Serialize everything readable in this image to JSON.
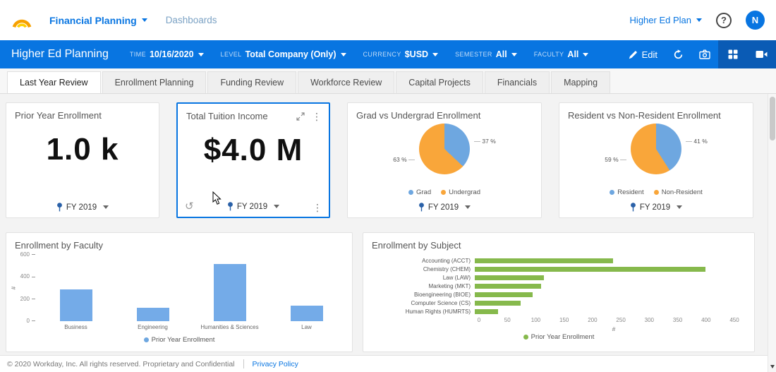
{
  "topbar": {
    "brand_nav": {
      "primary": "Financial Planning",
      "secondary": "Dashboards"
    },
    "plan_selector": "Higher Ed Plan",
    "avatar_initial": "N"
  },
  "icons": {
    "kebab": "⋮",
    "undo": "↺",
    "help": "?"
  },
  "toolbar": {
    "title": "Higher Ed Planning",
    "filters": [
      {
        "label": "TIME",
        "value": "10/16/2020"
      },
      {
        "label": "LEVEL",
        "value": "Total Company (Only)"
      },
      {
        "label": "CURRENCY",
        "value": "$USD"
      },
      {
        "label": "SEMESTER",
        "value": "All"
      },
      {
        "label": "FACULTY",
        "value": "All"
      }
    ],
    "edit_label": "Edit"
  },
  "tabs": [
    {
      "label": "Last Year Review",
      "active": true
    },
    {
      "label": "Enrollment Planning",
      "active": false
    },
    {
      "label": "Funding Review",
      "active": false
    },
    {
      "label": "Workforce Review",
      "active": false
    },
    {
      "label": "Capital Projects",
      "active": false
    },
    {
      "label": "Financials",
      "active": false
    },
    {
      "label": "Mapping",
      "active": false
    }
  ],
  "colors": {
    "workday_blue": "#0875e1",
    "toolbar_active_tile": "#0a5bb5",
    "pie_blue": "#6ea7e0",
    "pie_orange": "#f9a63a",
    "bar_blue": "#74abe8",
    "bar_green": "#86b94c"
  },
  "chart_data": [
    {
      "type": "kpi",
      "title": "Prior Year Enrollment",
      "value": "1.0 k",
      "period": "FY 2019"
    },
    {
      "type": "kpi",
      "title": "Total Tuition Income",
      "value": "$4.0 M",
      "period": "FY 2019"
    },
    {
      "type": "pie",
      "title": "Grad vs Undergrad Enrollment",
      "categories": [
        "Grad",
        "Undergrad"
      ],
      "values": [
        37,
        63
      ],
      "unit": "%",
      "value_labels": [
        "37 %",
        "63 %"
      ],
      "colors": [
        "#6ea7e0",
        "#f9a63a"
      ],
      "legend_position": "bottom",
      "period": "FY 2019"
    },
    {
      "type": "pie",
      "title": "Resident vs Non-Resident Enrollment",
      "categories": [
        "Resident",
        "Non-Resident"
      ],
      "values": [
        41,
        59
      ],
      "unit": "%",
      "value_labels": [
        "41 %",
        "59 %"
      ],
      "colors": [
        "#6ea7e0",
        "#f9a63a"
      ],
      "legend_position": "bottom",
      "period": "FY 2019"
    },
    {
      "type": "bar",
      "title": "Enrollment by Faculty",
      "categories": [
        "Business",
        "Engineering",
        "Humanities & Sciences",
        "Law"
      ],
      "series": [
        {
          "name": "Prior Year Enrollment",
          "values": [
            290,
            120,
            520,
            140
          ]
        }
      ],
      "ylabel": "#",
      "ylim": [
        0,
        600
      ],
      "yticks": [
        0,
        200,
        400,
        600
      ],
      "color": "#74abe8",
      "legend_position": "bottom"
    },
    {
      "type": "hbar",
      "title": "Enrollment by Subject",
      "categories": [
        "Accounting (ACCT)",
        "Chemistry (CHEM)",
        "Law (LAW)",
        "Marketing (MKT)",
        "Bioengineering (BIOE)",
        "Computer Science (CS)",
        "Human Rights (HUMRTS)"
      ],
      "series": [
        {
          "name": "Prior Year Enrollment",
          "values": [
            240,
            400,
            120,
            115,
            100,
            80,
            40
          ]
        }
      ],
      "xlabel": "#",
      "xlim": [
        0,
        450
      ],
      "xticks": [
        0,
        50,
        100,
        150,
        200,
        250,
        300,
        350,
        400,
        450
      ],
      "color": "#86b94c",
      "legend_position": "bottom"
    }
  ],
  "footer": {
    "copyright": "© 2020 Workday, Inc. All rights reserved. Proprietary and Confidential",
    "privacy": "Privacy Policy"
  }
}
